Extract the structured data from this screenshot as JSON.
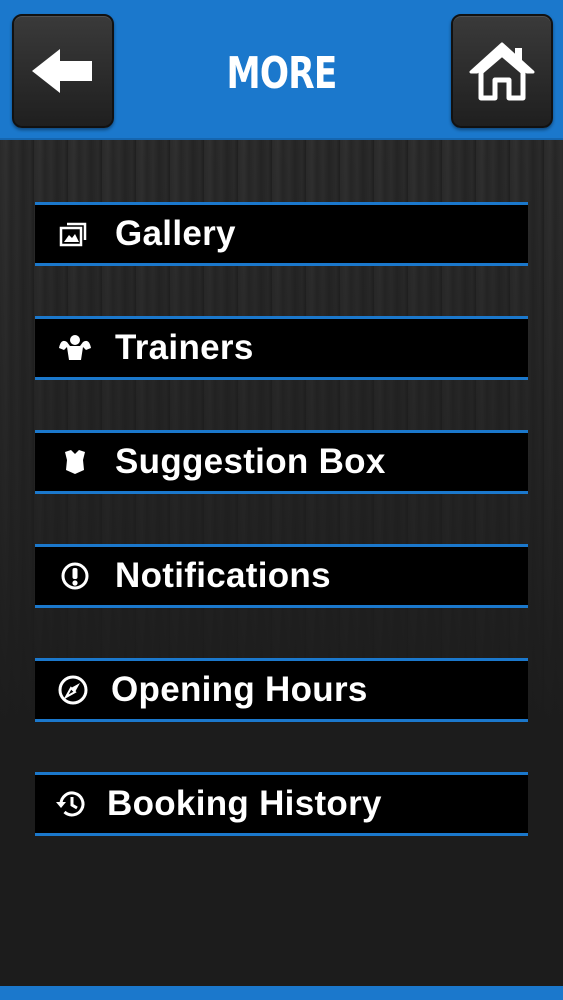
{
  "header": {
    "title": "MORE",
    "back_icon": "arrow-left-icon",
    "home_icon": "home-icon",
    "accent_color": "#1b78cc"
  },
  "menu": {
    "items": [
      {
        "label": "Gallery",
        "icon": "gallery-icon"
      },
      {
        "label": "Trainers",
        "icon": "muscle-icon"
      },
      {
        "label": "Suggestion Box",
        "icon": "shield-icon"
      },
      {
        "label": "Notifications",
        "icon": "exclamation-icon"
      },
      {
        "label": "Opening Hours",
        "icon": "compass-icon"
      },
      {
        "label": "Booking History",
        "icon": "history-icon"
      }
    ]
  }
}
